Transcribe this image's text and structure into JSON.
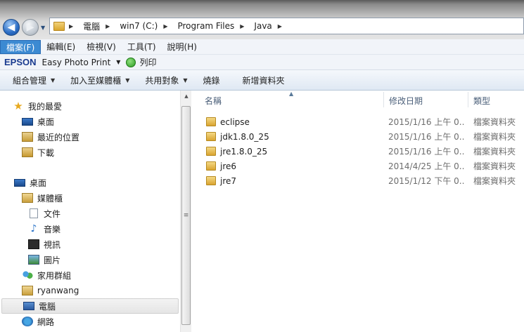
{
  "address": {
    "crumbs": [
      "電腦",
      "win7 (C:)",
      "Program Files",
      "Java"
    ]
  },
  "menu": [
    "檔案(F)",
    "編輯(E)",
    "檢視(V)",
    "工具(T)",
    "說明(H)"
  ],
  "epson": {
    "logo": "EPSON",
    "app": "Easy Photo Print",
    "print": "列印"
  },
  "commands": [
    "組合管理",
    "加入至媒體櫃",
    "共用對象",
    "燒錄",
    "新增資料夾"
  ],
  "nav": {
    "favorites": "我的最愛",
    "desktop_fav": "桌面",
    "recent": "最近的位置",
    "downloads": "下載",
    "desktop": "桌面",
    "libraries": "媒體櫃",
    "documents": "文件",
    "music": "音樂",
    "videos": "視訊",
    "pictures": "圖片",
    "homegroup": "家用群組",
    "user": "ryanwang",
    "computer": "電腦",
    "network": "網路"
  },
  "columns": {
    "name": "名稱",
    "date": "修改日期",
    "type": "類型"
  },
  "files": [
    {
      "name": "eclipse",
      "date": "2015/1/16 上午 0...",
      "type": "檔案資料夾"
    },
    {
      "name": "jdk1.8.0_25",
      "date": "2015/1/16 上午 0...",
      "type": "檔案資料夾"
    },
    {
      "name": "jre1.8.0_25",
      "date": "2015/1/16 上午 0...",
      "type": "檔案資料夾"
    },
    {
      "name": "jre6",
      "date": "2014/4/25 上午 0...",
      "type": "檔案資料夾"
    },
    {
      "name": "jre7",
      "date": "2015/1/12 下午 0...",
      "type": "檔案資料夾"
    }
  ]
}
